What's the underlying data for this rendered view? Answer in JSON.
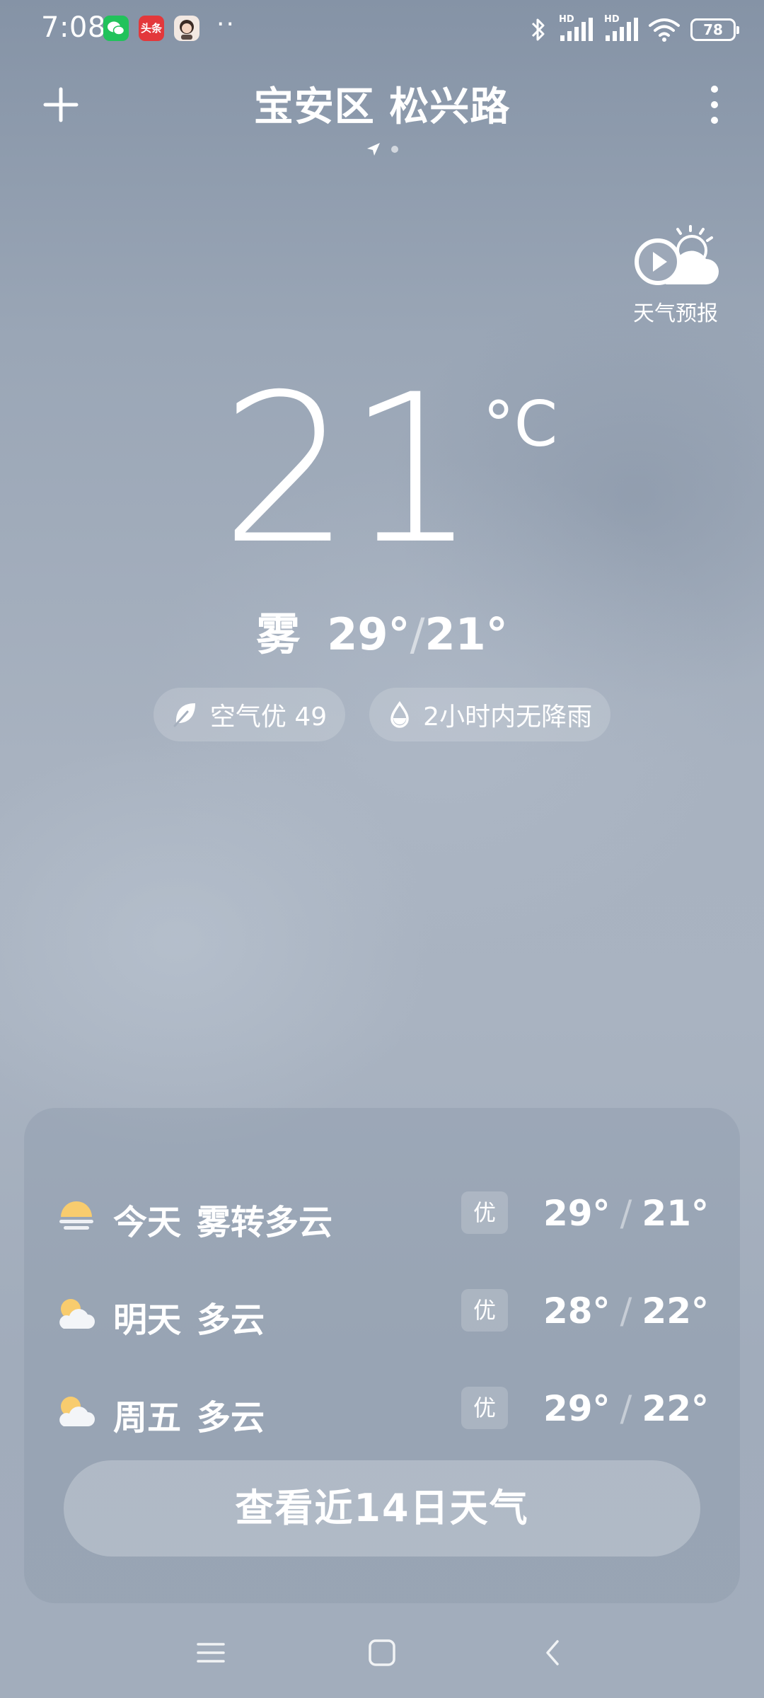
{
  "status_bar": {
    "time": "7:08",
    "app_icons": [
      "wechat-icon",
      "toutiao-icon",
      "avatar-icon"
    ],
    "toutiao_text": "头条",
    "more_notifications": "··",
    "signal_label_1": "HD",
    "signal_label_2": "HD",
    "battery": "78"
  },
  "header": {
    "location": "宝安区 松兴路"
  },
  "forecast_video": {
    "label": "天气预报"
  },
  "current": {
    "temperature": "21",
    "unit": "°C",
    "condition": "雾",
    "high": "29°",
    "low": "21°"
  },
  "chips": {
    "air": "空气优 49",
    "rain": "2小时内无降雨"
  },
  "forecast": [
    {
      "day": "今天",
      "condition": "雾转多云",
      "aqi": "优",
      "high": "29°",
      "low": "21°",
      "icon": "fog-icon"
    },
    {
      "day": "明天",
      "condition": "多云",
      "aqi": "优",
      "high": "28°",
      "low": "22°",
      "icon": "partly-cloudy-icon"
    },
    {
      "day": "周五",
      "condition": "多云",
      "aqi": "优",
      "high": "29°",
      "low": "22°",
      "icon": "partly-cloudy-icon"
    }
  ],
  "forecast_button": "查看近14日天气",
  "colors": {
    "sun": "#f8cc6e",
    "text": "#ffffff"
  }
}
